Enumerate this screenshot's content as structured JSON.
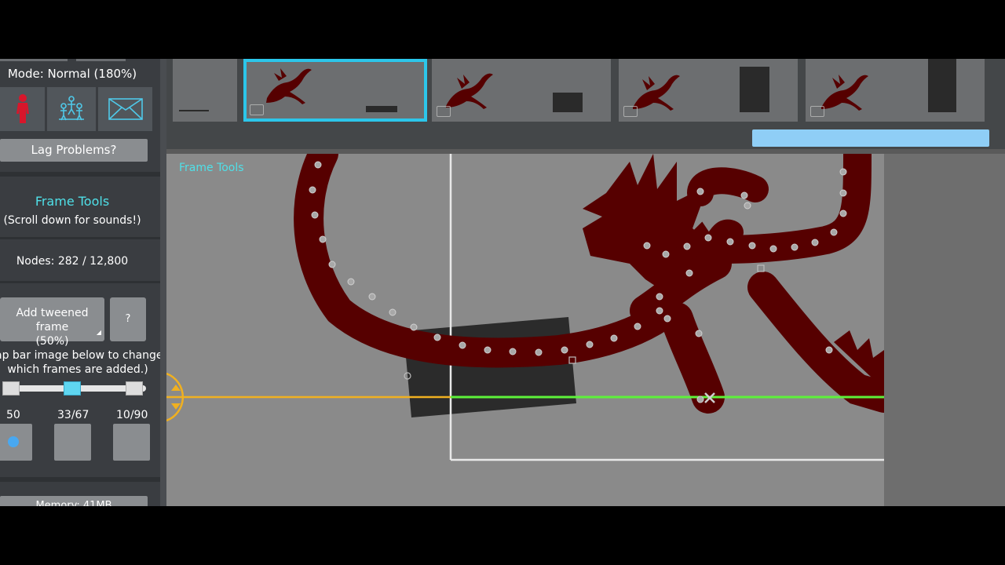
{
  "sidebar": {
    "mode_label": "Mode: Normal (180%)",
    "mode_buttons": [
      {
        "icon": "single-figure-icon",
        "color": "#d8162b"
      },
      {
        "icon": "multi-figure-icon",
        "color": "#4fc8e8"
      },
      {
        "icon": "envelope-icon",
        "color": "#4fc8e8"
      }
    ],
    "lag_button": "Lag Problems?",
    "frame_tools_title": "Frame Tools",
    "frame_tools_sub": "(Scroll down for sounds!)",
    "nodes": "Nodes: 282 / 12,800",
    "add_tween_line1": "Add tweened frame",
    "add_tween_line2": "(50%)",
    "help_button": "?",
    "tap_text_line1": "ap bar image below to change",
    "tap_text_line2": "which frames are added.)",
    "slider_values": [
      "50",
      "33/67",
      "10/90"
    ],
    "memory": "Memory: 41MB"
  },
  "timeline": {
    "frames_count": 5,
    "selected_frame": 2,
    "accent_color": "#2cc6ea"
  },
  "stage": {
    "label": "Frame Tools",
    "figure_color": "#560000",
    "ground_color": "#5df23a",
    "ground_left_color": "#f0b020"
  }
}
